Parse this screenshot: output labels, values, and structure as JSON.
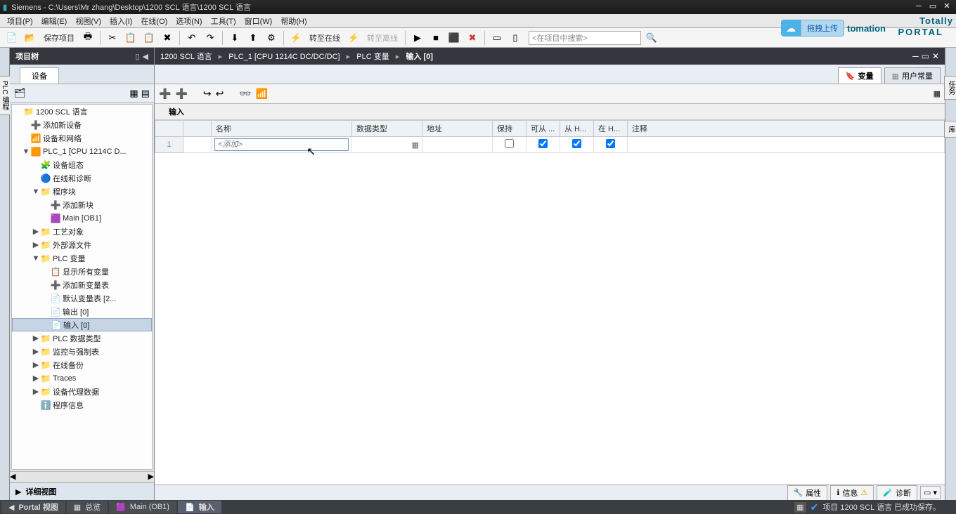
{
  "title": "Siemens  -  C:\\Users\\Mr zhang\\Desktop\\1200 SCL 语言\\1200 SCL 语言",
  "menu": [
    "项目(P)",
    "编辑(E)",
    "视图(V)",
    "插入(I)",
    "在线(O)",
    "选项(N)",
    "工具(T)",
    "窗口(W)",
    "帮助(H)"
  ],
  "brand_left": "Totally",
  "brand_right": "tomation",
  "portal": "PORTAL",
  "upload": "拖拽上传",
  "toolbar": {
    "save": "保存项目",
    "go_online": "转至在线",
    "go_offline": "转至离线",
    "search_ph": "<在项目中搜索>"
  },
  "left": {
    "header": "项目树",
    "tab": "设备",
    "detail": "详细视图"
  },
  "tree": [
    {
      "lvl": 0,
      "tg": "",
      "ic": "📁",
      "lb": "1200 SCL 语言"
    },
    {
      "lvl": 1,
      "tg": "",
      "ic": "➕",
      "lb": "添加新设备"
    },
    {
      "lvl": 1,
      "tg": "",
      "ic": "📶",
      "lb": "设备和网络"
    },
    {
      "lvl": 1,
      "tg": "▼",
      "ic": "🟧",
      "lb": "PLC_1 [CPU 1214C D..."
    },
    {
      "lvl": 2,
      "tg": "",
      "ic": "🧩",
      "lb": "设备组态"
    },
    {
      "lvl": 2,
      "tg": "",
      "ic": "🔵",
      "lb": "在线和诊断"
    },
    {
      "lvl": 2,
      "tg": "▼",
      "ic": "📁",
      "lb": "程序块"
    },
    {
      "lvl": 3,
      "tg": "",
      "ic": "➕",
      "lb": "添加新块"
    },
    {
      "lvl": 3,
      "tg": "",
      "ic": "🟪",
      "lb": "Main [OB1]"
    },
    {
      "lvl": 2,
      "tg": "▶",
      "ic": "📁",
      "lb": "工艺对象"
    },
    {
      "lvl": 2,
      "tg": "▶",
      "ic": "📁",
      "lb": "外部源文件"
    },
    {
      "lvl": 2,
      "tg": "▼",
      "ic": "📁",
      "lb": "PLC 变量"
    },
    {
      "lvl": 3,
      "tg": "",
      "ic": "📋",
      "lb": "显示所有变量"
    },
    {
      "lvl": 3,
      "tg": "",
      "ic": "➕",
      "lb": "添加新变量表"
    },
    {
      "lvl": 3,
      "tg": "",
      "ic": "📄",
      "lb": "默认变量表 [2..."
    },
    {
      "lvl": 3,
      "tg": "",
      "ic": "📄",
      "lb": "输出 [0]"
    },
    {
      "lvl": 3,
      "tg": "",
      "ic": "📄",
      "lb": "输入 [0]",
      "sel": true
    },
    {
      "lvl": 2,
      "tg": "▶",
      "ic": "📁",
      "lb": "PLC 数据类型"
    },
    {
      "lvl": 2,
      "tg": "▶",
      "ic": "📁",
      "lb": "监控与强制表"
    },
    {
      "lvl": 2,
      "tg": "▶",
      "ic": "📁",
      "lb": "在线备份"
    },
    {
      "lvl": 2,
      "tg": "▶",
      "ic": "📁",
      "lb": "Traces"
    },
    {
      "lvl": 2,
      "tg": "▶",
      "ic": "📁",
      "lb": "设备代理数据"
    },
    {
      "lvl": 2,
      "tg": "",
      "ic": "ℹ️",
      "lb": "程序信息"
    }
  ],
  "breadcrumb": [
    "1200 SCL 语言",
    "PLC_1 [CPU 1214C DC/DC/DC]",
    "PLC 变量",
    "输入 [0]"
  ],
  "ed_tabs": {
    "var": "变量",
    "const": "用户常量"
  },
  "section": "输入",
  "cols": [
    "",
    "名称",
    "数据类型",
    "地址",
    "保持",
    "可从 ...",
    "从 H...",
    "在 H...",
    "注释"
  ],
  "row1": {
    "num": "1",
    "add_ph": "<添加>"
  },
  "info_panels": {
    "prop": "属性",
    "info": "信息",
    "diag": "诊断"
  },
  "status": {
    "portal": "Portal 视图",
    "overview": "总览",
    "main": "Main (OB1)",
    "input": "输入",
    "msg": "项目 1200 SCL 语言 已成功保存。"
  },
  "side_left": "PLC 编程",
  "side_right": [
    "任务",
    "库"
  ]
}
